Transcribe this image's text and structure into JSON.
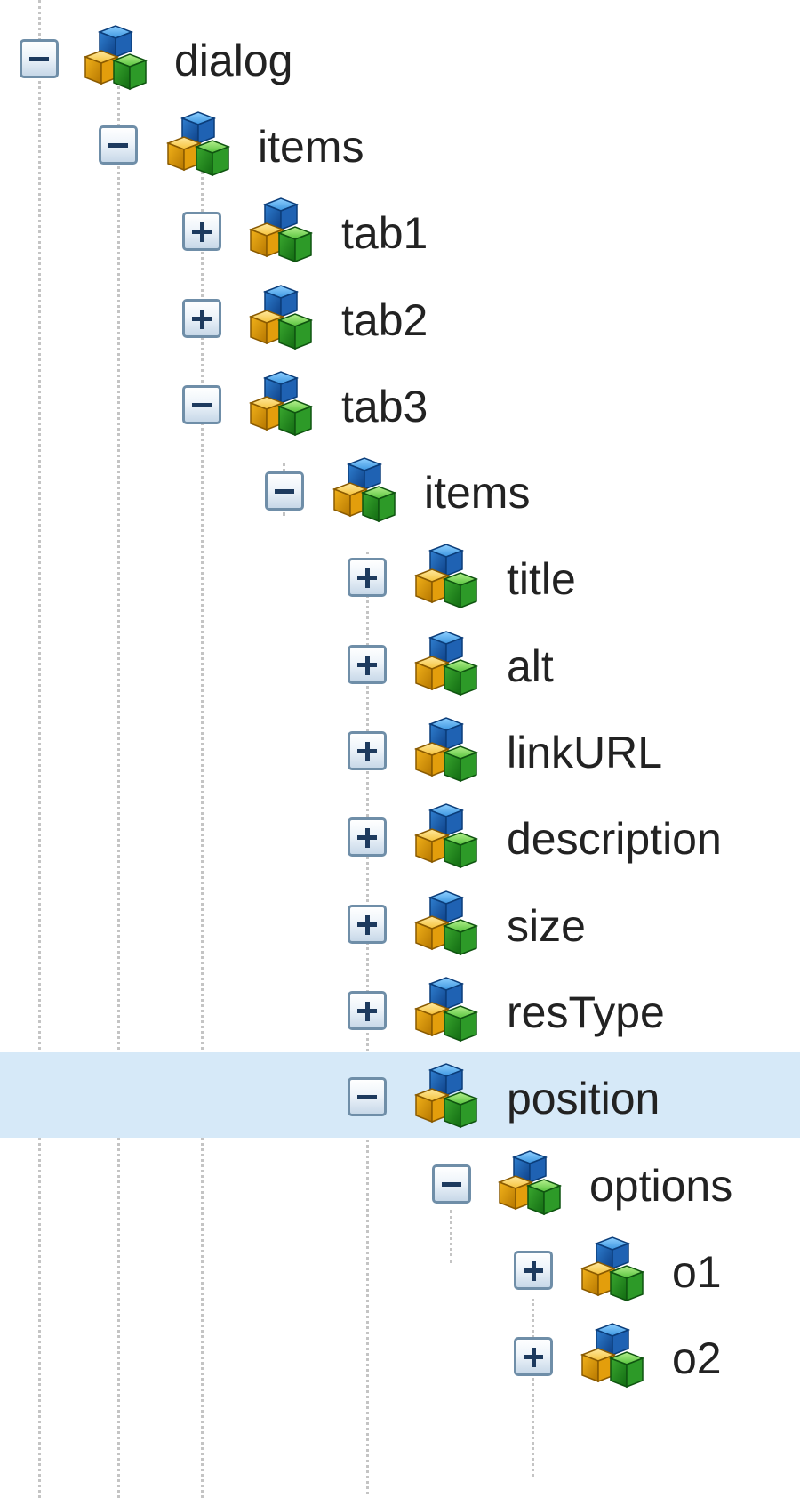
{
  "tree": {
    "nodes": [
      {
        "label": "dialog",
        "expanded": true,
        "selected": false
      },
      {
        "label": "items",
        "expanded": true,
        "selected": false
      },
      {
        "label": "tab1",
        "expanded": false,
        "selected": false
      },
      {
        "label": "tab2",
        "expanded": false,
        "selected": false
      },
      {
        "label": "tab3",
        "expanded": true,
        "selected": false
      },
      {
        "label": "items",
        "expanded": true,
        "selected": false
      },
      {
        "label": "title",
        "expanded": false,
        "selected": false
      },
      {
        "label": "alt",
        "expanded": false,
        "selected": false
      },
      {
        "label": "linkURL",
        "expanded": false,
        "selected": false
      },
      {
        "label": "description",
        "expanded": false,
        "selected": false
      },
      {
        "label": "size",
        "expanded": false,
        "selected": false
      },
      {
        "label": "resType",
        "expanded": false,
        "selected": false
      },
      {
        "label": "position",
        "expanded": true,
        "selected": true
      },
      {
        "label": "options",
        "expanded": true,
        "selected": false
      },
      {
        "label": "o1",
        "expanded": false,
        "selected": false
      },
      {
        "label": "o2",
        "expanded": false,
        "selected": false
      }
    ]
  },
  "icons": {
    "node": "node-icon",
    "expand": "expand-icon",
    "collapse": "collapse-icon"
  },
  "colors": {
    "selection": "#d6e9f8",
    "toggle_border": "#6f8ea8",
    "label_text": "#222222",
    "cube_blue": "#2f86d6",
    "cube_yellow": "#f2b824",
    "cube_green": "#3fae3a"
  }
}
